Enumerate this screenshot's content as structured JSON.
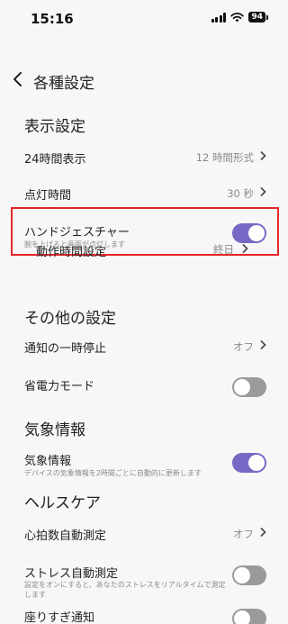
{
  "status": {
    "time": "15:16",
    "battery": "94"
  },
  "nav": {
    "title": "各種設定"
  },
  "display_section": {
    "title": "表示設定",
    "time_format": {
      "label": "24時間表示",
      "value": "12 時間形式"
    },
    "screen_time": {
      "label": "点灯時間",
      "value": "30 秒"
    },
    "hand_gesture": {
      "label": "ハンドジェスチャー",
      "sub": "腕を上げると画面が点灯します",
      "enabled": true
    },
    "active_time": {
      "label": "動作時間設定",
      "value": "終日"
    }
  },
  "other_section": {
    "title": "その他の設定",
    "pause_notifications": {
      "label": "通知の一時停止",
      "value": "オフ"
    },
    "power_saving": {
      "label": "省電力モード",
      "enabled": false
    }
  },
  "weather_section": {
    "title": "気象情報",
    "weather": {
      "label": "気象情報",
      "sub": "デバイスの気象情報を2時間ごとに自動的に更新します",
      "enabled": true
    }
  },
  "health_section": {
    "title": "ヘルスケア",
    "heart_rate": {
      "label": "心拍数自動測定",
      "value": "オフ"
    },
    "stress": {
      "label": "ストレス自動測定",
      "sub": "設定をオンにすると、あなたのストレスをリアルタイムで測定します",
      "enabled": false
    },
    "sitting": {
      "label": "座りすぎ通知",
      "enabled": false
    }
  },
  "colors": {
    "toggle_on": "#7569c5",
    "toggle_off": "#9a9a9a",
    "highlight": "#e8262a"
  }
}
